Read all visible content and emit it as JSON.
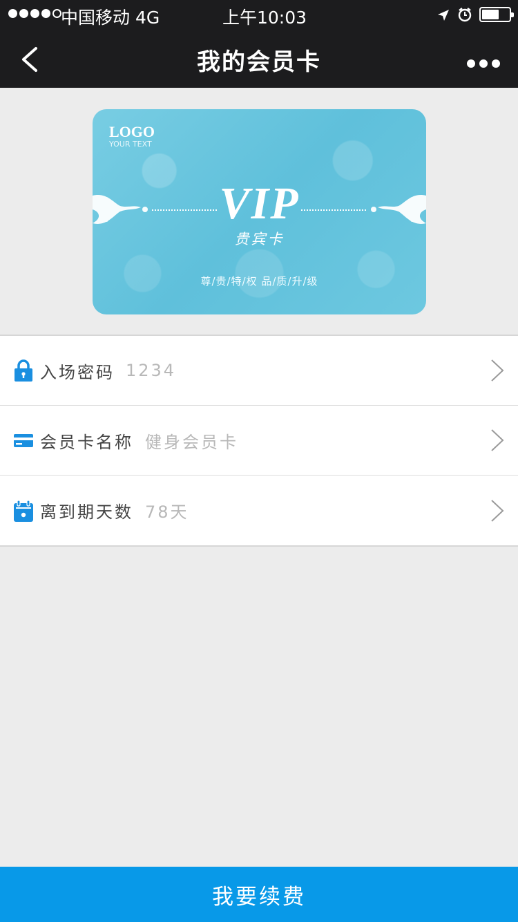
{
  "status_bar": {
    "carrier": "中国移动   4G",
    "time": "上午10:03"
  },
  "nav": {
    "title": "我的会员卡"
  },
  "card": {
    "logo": "LOGO",
    "logo_sub": "YOUR TEXT",
    "title": "VIP",
    "subtitle": "贵宾卡",
    "slogan": "尊/贵/特/权   品/质/升/级"
  },
  "rows": [
    {
      "label": "入场密码",
      "value": "1234",
      "icon": "lock-icon"
    },
    {
      "label": "会员卡名称",
      "value": "健身会员卡",
      "icon": "card-icon"
    },
    {
      "label": "离到期天数",
      "value": "78天",
      "icon": "calendar-icon"
    }
  ],
  "renew_button": {
    "label": "我要续费"
  },
  "colors": {
    "topbar": "#1c1c1e",
    "accent": "#0899e8",
    "card": "#6dc8e0",
    "background": "#ececec"
  }
}
